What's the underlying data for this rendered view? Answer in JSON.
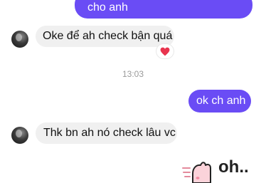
{
  "messages": [
    {
      "direction": "outgoing",
      "text": "cho anh"
    },
    {
      "direction": "incoming",
      "text": "Oke để ah check bận quá",
      "reaction": "heart"
    },
    {
      "direction": "outgoing",
      "text": "ok ch anh"
    },
    {
      "direction": "incoming",
      "text": "Thk bn ah nó check lâu vc"
    }
  ],
  "timestamp": "13:03",
  "sticker": {
    "text": "oh..",
    "icon": "bunny-oh-sticker"
  },
  "colors": {
    "outgoing_bubble": "#6a4cf5",
    "incoming_bubble": "#f0f0f0",
    "reaction_heart": "#e8344e"
  }
}
